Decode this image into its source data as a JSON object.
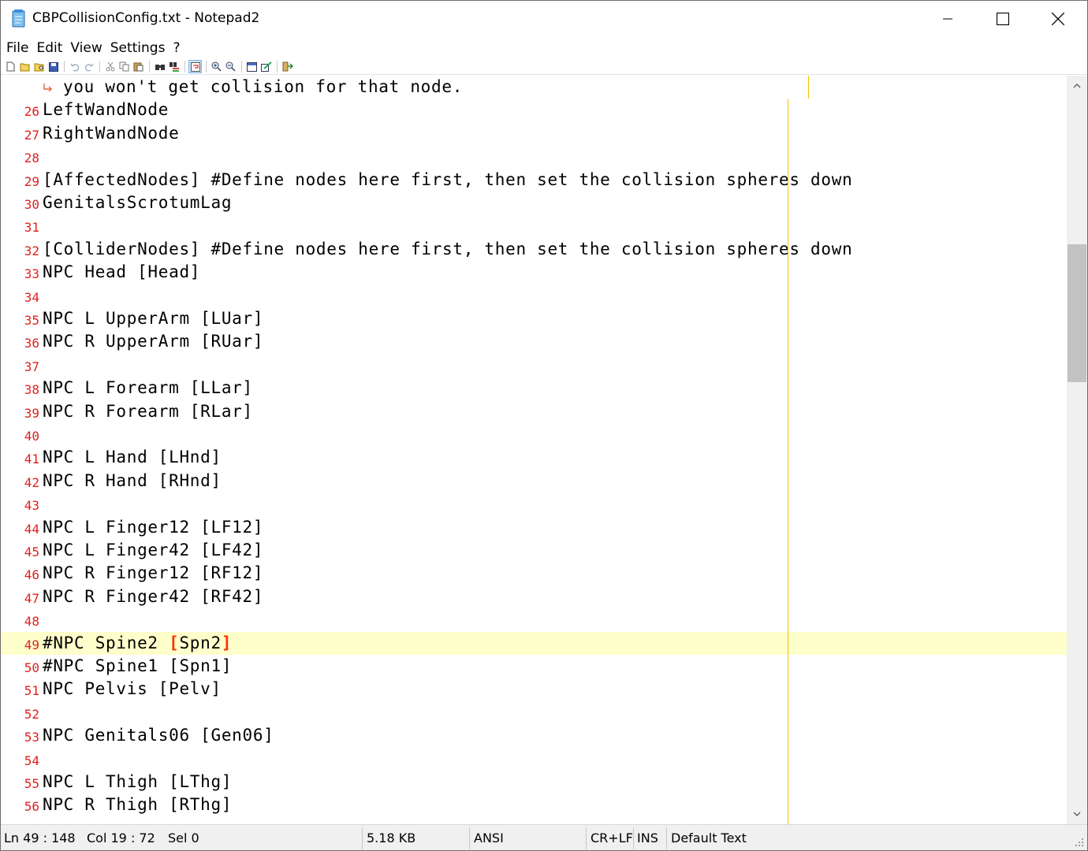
{
  "window": {
    "title": "CBPCollisionConfig.txt - Notepad2"
  },
  "menu": {
    "items": [
      "File",
      "Edit",
      "View",
      "Settings",
      "?"
    ]
  },
  "toolbar": {
    "icons": [
      "new-file-icon",
      "open-file-icon",
      "browse-icon",
      "save-icon",
      "undo-icon",
      "redo-icon",
      "cut-icon",
      "copy-icon",
      "paste-icon",
      "find-icon",
      "replace-icon",
      "word-wrap-icon",
      "zoom-in-icon",
      "zoom-out-icon",
      "scheme-icon",
      "customize-schemes-icon",
      "exit-icon"
    ]
  },
  "editor": {
    "wrapped_continuation": "you won't get collision for that node.",
    "current_line": "49",
    "lines": [
      {
        "num": "26",
        "text": "LeftWandNode"
      },
      {
        "num": "27",
        "text": "RightWandNode"
      },
      {
        "num": "28",
        "text": ""
      },
      {
        "num": "29",
        "text": "[AffectedNodes] #Define nodes here first, then set the collision spheres down"
      },
      {
        "num": "30",
        "text": "GenitalsScrotumLag"
      },
      {
        "num": "31",
        "text": ""
      },
      {
        "num": "32",
        "text": "[ColliderNodes] #Define nodes here first, then set the collision spheres down"
      },
      {
        "num": "33",
        "text": "NPC Head [Head]"
      },
      {
        "num": "34",
        "text": ""
      },
      {
        "num": "35",
        "text": "NPC L UpperArm [LUar]"
      },
      {
        "num": "36",
        "text": "NPC R UpperArm [RUar]"
      },
      {
        "num": "37",
        "text": ""
      },
      {
        "num": "38",
        "text": "NPC L Forearm [LLar]"
      },
      {
        "num": "39",
        "text": "NPC R Forearm [RLar]"
      },
      {
        "num": "40",
        "text": ""
      },
      {
        "num": "41",
        "text": "NPC L Hand [LHnd]"
      },
      {
        "num": "42",
        "text": "NPC R Hand [RHnd]"
      },
      {
        "num": "43",
        "text": ""
      },
      {
        "num": "44",
        "text": "NPC L Finger12 [LF12]"
      },
      {
        "num": "45",
        "text": "NPC L Finger42 [LF42]"
      },
      {
        "num": "46",
        "text": "NPC R Finger12 [RF12]"
      },
      {
        "num": "47",
        "text": "NPC R Finger42 [RF42]"
      },
      {
        "num": "48",
        "text": ""
      },
      {
        "num": "49",
        "text_before": "#NPC Spine2 ",
        "brace_open": "[",
        "text_mid": "Spn2",
        "brace_close": "]"
      },
      {
        "num": "50",
        "text": "#NPC Spine1 [Spn1]"
      },
      {
        "num": "51",
        "text": "NPC Pelvis [Pelv]"
      },
      {
        "num": "52",
        "text": ""
      },
      {
        "num": "53",
        "text": "NPC Genitals06 [Gen06]"
      },
      {
        "num": "54",
        "text": ""
      },
      {
        "num": "55",
        "text": "NPC L Thigh [LThg]"
      },
      {
        "num": "56",
        "text": "NPC R Thigh [RThg]"
      }
    ]
  },
  "scrollbar": {
    "position_fraction": 0.26
  },
  "statusbar": {
    "position": "Ln 49 : 148",
    "column": "Col 19 : 72",
    "selection": "Sel 0",
    "size": "5.18 KB",
    "encoding": "ANSI",
    "eol": "CR+LF",
    "ovr": "INS",
    "scheme": "Default Text"
  },
  "colors": {
    "line_number": "#e02020",
    "current_line_bg": "#ffffcc",
    "brace_match": "#ff3300",
    "long_line_marker": "#f2c400"
  }
}
